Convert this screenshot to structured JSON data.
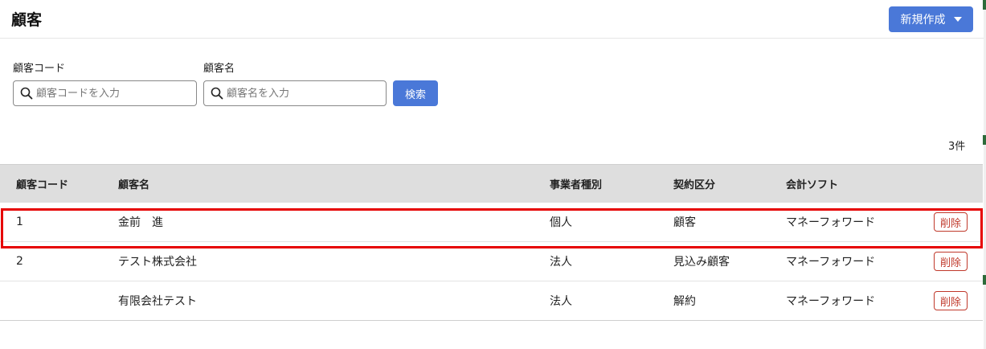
{
  "page": {
    "title": "顧客",
    "new_button_label": "新規作成"
  },
  "filters": {
    "code_label": "顧客コード",
    "code_placeholder": "顧客コードを入力",
    "name_label": "顧客名",
    "name_placeholder": "顧客名を入力",
    "search_button": "検索"
  },
  "result_count": "3件",
  "table": {
    "headers": [
      "顧客コード",
      "顧客名",
      "事業者種別",
      "契約区分",
      "会計ソフト"
    ],
    "rows": [
      {
        "code": "1",
        "name": "金前　進",
        "type": "個人",
        "contract": "顧客",
        "software": "マネーフォワード",
        "action": "削除"
      },
      {
        "code": "2",
        "name": "テスト株式会社",
        "type": "法人",
        "contract": "見込み顧客",
        "software": "マネーフォワード",
        "action": "削除"
      },
      {
        "code": "",
        "name": "有限会社テスト",
        "type": "法人",
        "contract": "解約",
        "software": "マネーフォワード",
        "action": "削除"
      }
    ]
  },
  "colors": {
    "accent": "#4a78d8",
    "delete": "#c0392b",
    "highlight": "#e60000",
    "header_bg": "#dedede"
  },
  "icons": {
    "search": "search-icon",
    "dropdown": "caret-down-icon"
  }
}
